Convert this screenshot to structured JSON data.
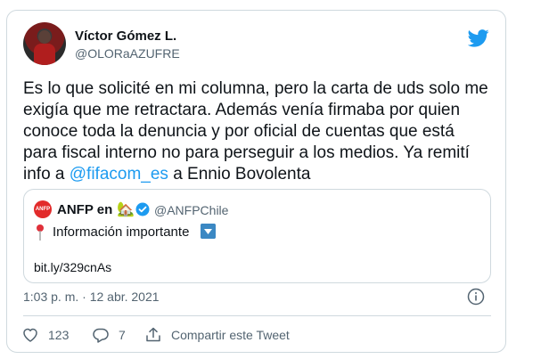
{
  "tweet": {
    "author_name": "Víctor Gómez L.",
    "author_handle": "@OLORaAZUFRE",
    "text_before": "Es lo que solicité en mi columna, pero la carta de uds solo me exigía que me retractara. Además venía firmaba por quien conoce toda la denuncia y por oficial de cuentas que está para fiscal interno no para perseguir a los medios. Ya remití info a ",
    "mention": "@fifacom_es",
    "text_after": " a Ennio Bovolenta",
    "timestamp": "1:03 p. m. · 12 abr. 2021"
  },
  "quote": {
    "avatar_text": "ANFP",
    "name": "ANFP en",
    "house_emoji": "🏡",
    "handle": "@ANFPChile",
    "text": "Información importante",
    "link": "bit.ly/329cnAs"
  },
  "actions": {
    "likes": "123",
    "replies": "7",
    "share_label": "Compartir este Tweet"
  },
  "colors": {
    "accent": "#1d9bf0",
    "muted": "#536471",
    "border": "#cfd9de"
  },
  "icons": [
    "twitter-bird-icon",
    "verified-badge-icon",
    "pin-icon",
    "down-arrow-icon",
    "info-icon",
    "heart-icon",
    "reply-icon",
    "share-icon"
  ]
}
